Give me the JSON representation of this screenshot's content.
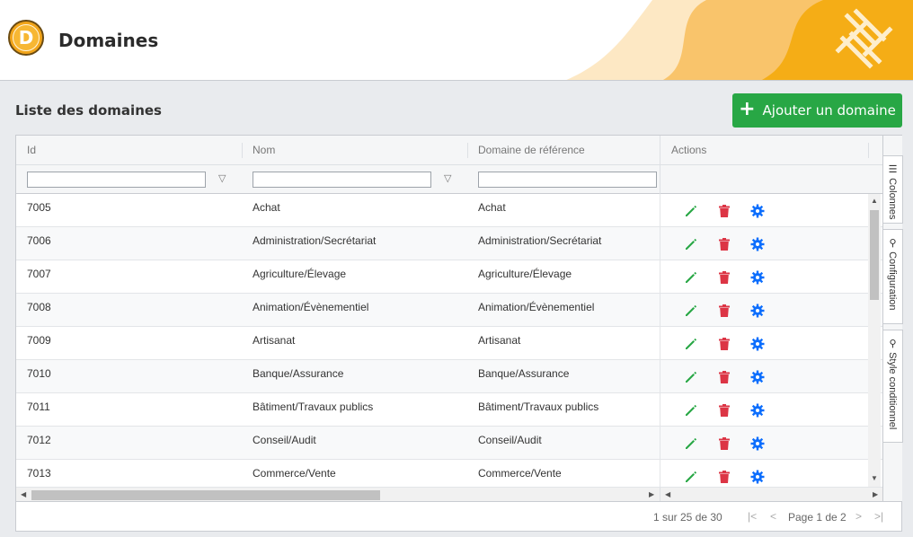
{
  "header": {
    "logo_letter": "D",
    "title": "Domaines"
  },
  "section": {
    "title": "Liste des domaines",
    "add_button": "Ajouter un domaine"
  },
  "grid": {
    "columns": [
      "Id",
      "Nom",
      "Domaine de référence",
      "Actions"
    ],
    "rows": [
      {
        "id": "7005",
        "nom": "Achat",
        "ref": "Achat"
      },
      {
        "id": "7006",
        "nom": "Administration/Secrétariat",
        "ref": "Administration/Secrétariat"
      },
      {
        "id": "7007",
        "nom": "Agriculture/Élevage",
        "ref": "Agriculture/Élevage"
      },
      {
        "id": "7008",
        "nom": "Animation/Évènementiel",
        "ref": "Animation/Évènementiel"
      },
      {
        "id": "7009",
        "nom": "Artisanat",
        "ref": "Artisanat"
      },
      {
        "id": "7010",
        "nom": "Banque/Assurance",
        "ref": "Banque/Assurance"
      },
      {
        "id": "7011",
        "nom": "Bâtiment/Travaux publics",
        "ref": "Bâtiment/Travaux publics"
      },
      {
        "id": "7012",
        "nom": "Conseil/Audit",
        "ref": "Conseil/Audit"
      },
      {
        "id": "7013",
        "nom": "Commerce/Vente",
        "ref": "Commerce/Vente"
      }
    ],
    "row_actions": [
      "pencil-icon",
      "trash-icon",
      "gear-icon"
    ]
  },
  "side_panel": {
    "tabs": [
      "Colonnes",
      "Configuration",
      "Style conditionnel"
    ]
  },
  "pagination": {
    "summary": "1 sur 25 de 30",
    "page_label": "Page 1 de 2"
  },
  "colors": {
    "accent_green": "#28a745",
    "edit_green": "#28a745",
    "delete_red": "#dc3545",
    "config_blue": "#0d6efd",
    "brand_orange": "#f2a51a"
  }
}
